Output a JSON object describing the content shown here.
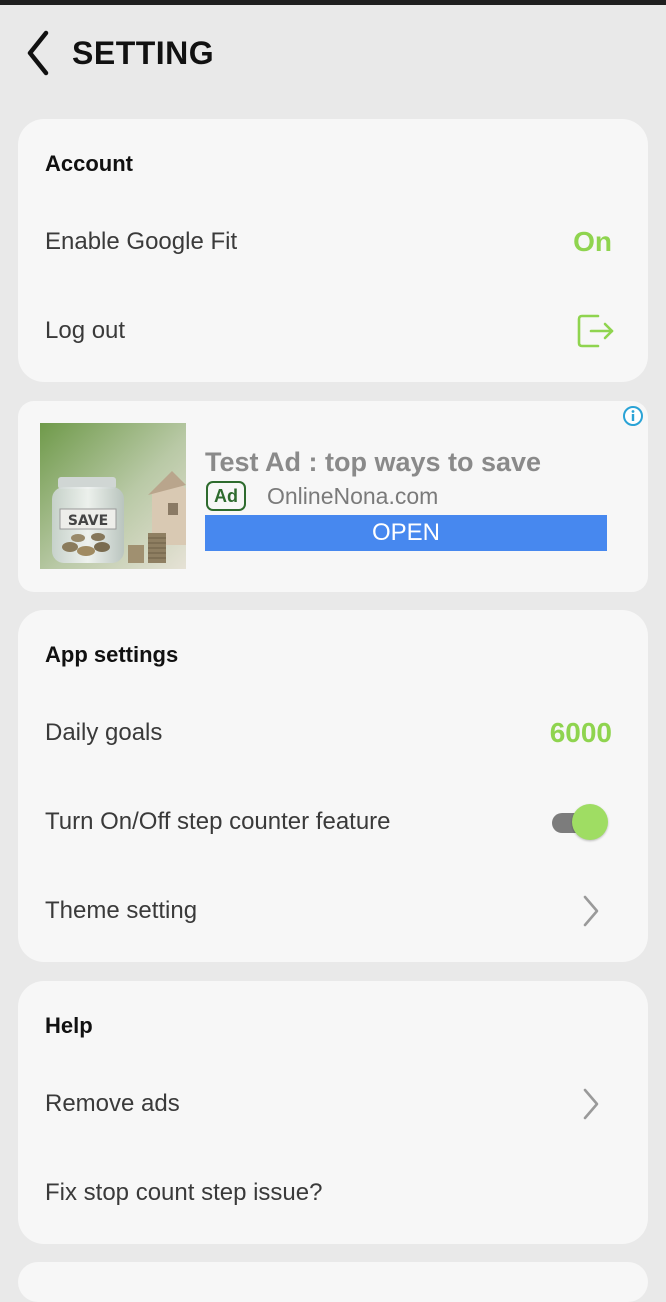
{
  "header": {
    "title": "SETTING"
  },
  "account": {
    "section_title": "Account",
    "google_fit_label": "Enable Google Fit",
    "google_fit_value": "On",
    "logout_label": "Log out"
  },
  "ad": {
    "headline": "Test Ad : top ways to save",
    "badge": "Ad",
    "domain": "OnlineNona.com",
    "cta": "OPEN",
    "jar_label": "SAVE"
  },
  "app_settings": {
    "section_title": "App settings",
    "daily_goals_label": "Daily goals",
    "daily_goals_value": "6000",
    "step_counter_label": "Turn On/Off step counter feature",
    "step_counter_enabled": true,
    "theme_label": "Theme setting"
  },
  "help": {
    "section_title": "Help",
    "remove_ads_label": "Remove ads",
    "fix_label": "Fix stop count step issue?"
  },
  "colors": {
    "accent_green": "#8fd44f",
    "ad_button_blue": "#4788ef",
    "card_bg": "#f7f7f7",
    "page_bg": "#e9e9e9"
  }
}
